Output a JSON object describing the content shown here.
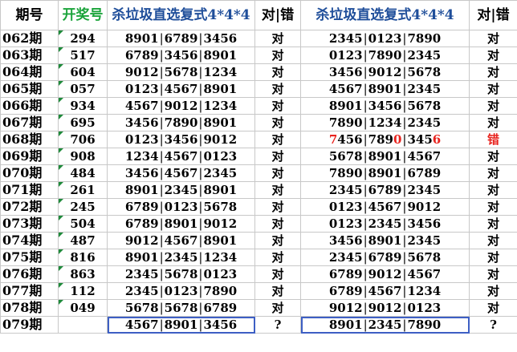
{
  "headers": {
    "period": "期号",
    "draw": "开奖号",
    "method1": "杀垃圾直选复式4*4*4",
    "result1": "对|错",
    "method2": "杀垃圾直选复式4*4*4",
    "result2": "对|错"
  },
  "rows": [
    {
      "period": "062期",
      "draw": "294",
      "a": [
        "8901",
        "6789",
        "3456"
      ],
      "ra": "对",
      "b": [
        "2345",
        "0123",
        "7890"
      ],
      "rb": "对"
    },
    {
      "period": "063期",
      "draw": "517",
      "a": [
        "6789",
        "3456",
        "8901"
      ],
      "ra": "对",
      "b": [
        "0123",
        "7890",
        "2345"
      ],
      "rb": "对"
    },
    {
      "period": "064期",
      "draw": "604",
      "a": [
        "9012",
        "5678",
        "1234"
      ],
      "ra": "对",
      "b": [
        "3456",
        "9012",
        "5678"
      ],
      "rb": "对"
    },
    {
      "period": "065期",
      "draw": "057",
      "a": [
        "0123",
        "4567",
        "8901"
      ],
      "ra": "对",
      "b": [
        "4567",
        "8901",
        "2345"
      ],
      "rb": "对"
    },
    {
      "period": "066期",
      "draw": "934",
      "a": [
        "4567",
        "9012",
        "1234"
      ],
      "ra": "对",
      "b": [
        "8901",
        "3456",
        "5678"
      ],
      "rb": "对"
    },
    {
      "period": "067期",
      "draw": "695",
      "a": [
        "3456",
        "7890",
        "8901"
      ],
      "ra": "对",
      "b": [
        "7890",
        "1234",
        "2345"
      ],
      "rb": "对"
    },
    {
      "period": "068期",
      "draw": "706",
      "a": [
        "0123",
        "3456",
        "9012"
      ],
      "ra": "对",
      "b": [
        "7456",
        "7890",
        "3456"
      ],
      "rb": "错",
      "bred": [
        [
          0
        ],
        [
          3
        ],
        [
          3
        ]
      ]
    },
    {
      "period": "069期",
      "draw": "908",
      "a": [
        "1234",
        "4567",
        "0123"
      ],
      "ra": "对",
      "b": [
        "5678",
        "8901",
        "4567"
      ],
      "rb": "对"
    },
    {
      "period": "070期",
      "draw": "484",
      "a": [
        "3456",
        "4567",
        "2345"
      ],
      "ra": "对",
      "b": [
        "7890",
        "8901",
        "6789"
      ],
      "rb": "对"
    },
    {
      "period": "071期",
      "draw": "261",
      "a": [
        "8901",
        "2345",
        "8901"
      ],
      "ra": "对",
      "b": [
        "2345",
        "6789",
        "2345"
      ],
      "rb": "对"
    },
    {
      "period": "072期",
      "draw": "245",
      "a": [
        "6789",
        "0123",
        "5678"
      ],
      "ra": "对",
      "b": [
        "0123",
        "4567",
        "9012"
      ],
      "rb": "对"
    },
    {
      "period": "073期",
      "draw": "504",
      "a": [
        "6789",
        "8901",
        "9012"
      ],
      "ra": "对",
      "b": [
        "0123",
        "2345",
        "3456"
      ],
      "rb": "对"
    },
    {
      "period": "074期",
      "draw": "487",
      "a": [
        "9012",
        "4567",
        "8901"
      ],
      "ra": "对",
      "b": [
        "3456",
        "8901",
        "2345"
      ],
      "rb": "对"
    },
    {
      "period": "075期",
      "draw": "816",
      "a": [
        "8901",
        "2345",
        "1234"
      ],
      "ra": "对",
      "b": [
        "2345",
        "6789",
        "5678"
      ],
      "rb": "对"
    },
    {
      "period": "076期",
      "draw": "863",
      "a": [
        "2345",
        "5678",
        "0123"
      ],
      "ra": "对",
      "b": [
        "6789",
        "9012",
        "4567"
      ],
      "rb": "对"
    },
    {
      "period": "077期",
      "draw": "112",
      "a": [
        "2345",
        "0123",
        "7890"
      ],
      "ra": "对",
      "b": [
        "6789",
        "4567",
        "1234"
      ],
      "rb": "对"
    },
    {
      "period": "078期",
      "draw": "049",
      "a": [
        "5678",
        "5678",
        "6789"
      ],
      "ra": "对",
      "b": [
        "9012",
        "9012",
        "0123"
      ],
      "rb": "对"
    },
    {
      "period": "079期",
      "draw": "",
      "a": [
        "4567",
        "8901",
        "3456"
      ],
      "ra": "?",
      "b": [
        "8901",
        "2345",
        "7890"
      ],
      "rb": "?"
    }
  ],
  "colors": {
    "header_green": "#1aa33a",
    "header_blue": "#1f4e9a",
    "wrong_red": "#e8231e",
    "box_blue": "#3d5fc4"
  }
}
